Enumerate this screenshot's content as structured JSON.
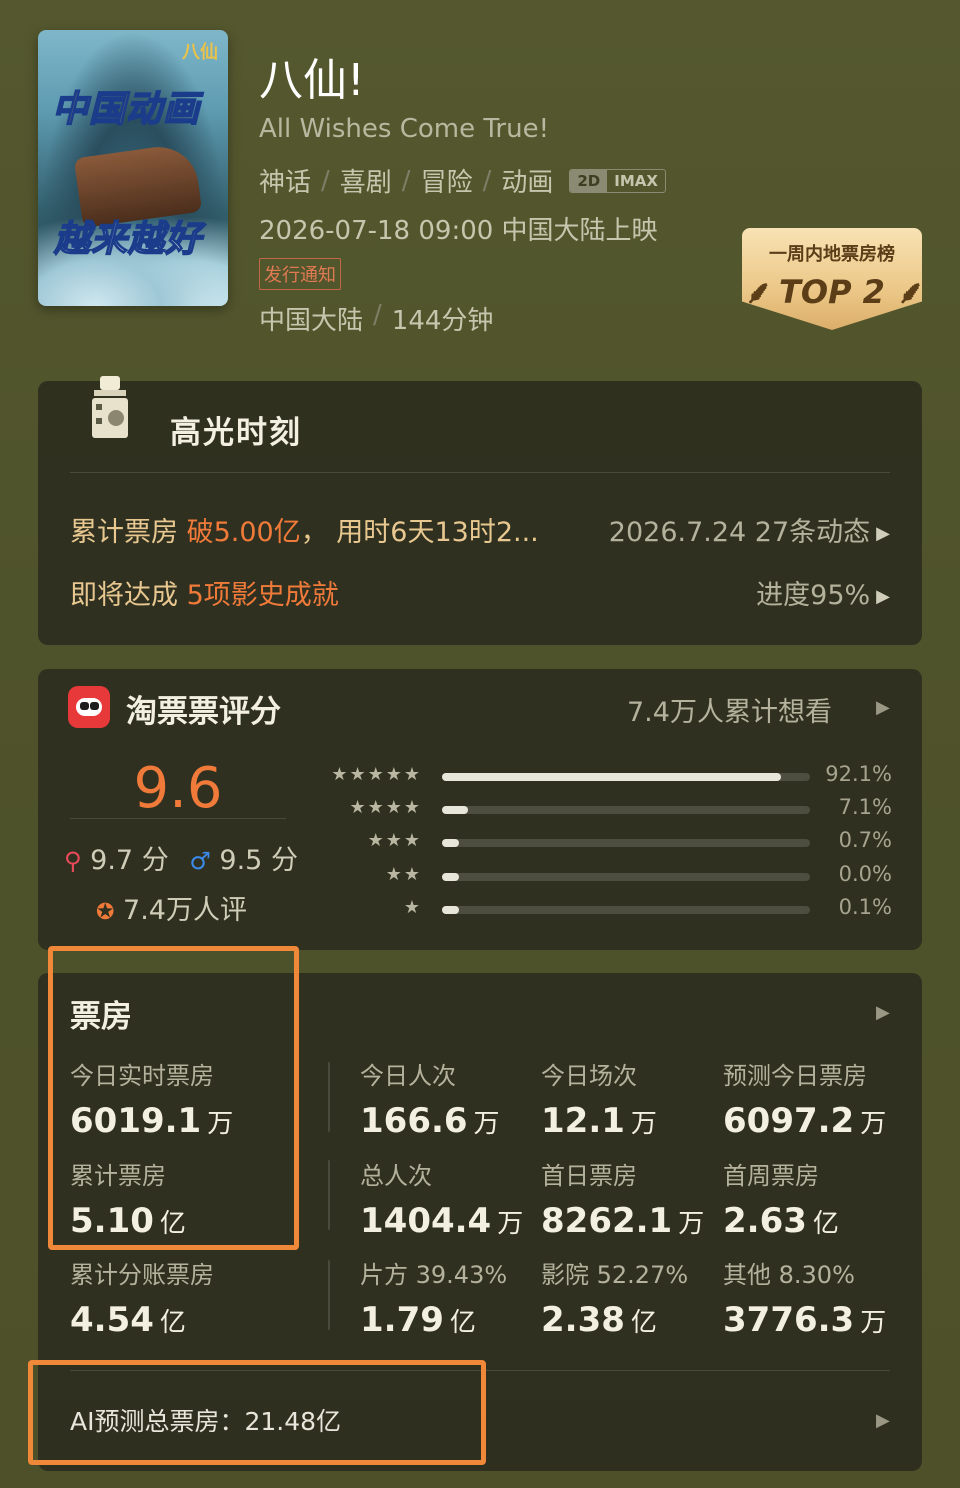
{
  "movie": {
    "poster_line1": "中国动画",
    "poster_line2": "越来越好",
    "poster_logo": "八仙",
    "title": "八仙!",
    "subtitle": "All Wishes Come True!",
    "genres": [
      "神话",
      "喜剧",
      "冒险",
      "动画"
    ],
    "formats": [
      "2D",
      "IMAX"
    ],
    "release": "2026-07-18 09:00 中国大陆上映",
    "notice": "发行通知",
    "region": "中国大陆",
    "duration": "144分钟"
  },
  "rank_badge": {
    "line1": "一周内地票房榜",
    "line2": "TOP 2"
  },
  "highlights": {
    "title": "高光时刻",
    "row1_prefix": "累计票房 ",
    "row1_hot": "破5.00亿",
    "row1_suffix": "， 用时6天13时2...",
    "row1_right": "2026.7.24  27条动态",
    "row2_prefix": "即将达成 ",
    "row2_hot": "5项影史成就",
    "row2_right": "进度95%"
  },
  "rating": {
    "platform": "淘票票评分",
    "want_to_see": "7.4万人累计想看",
    "score": "9.6",
    "female_score": "9.7",
    "male_score": "9.5",
    "score_unit": "分",
    "reviews": "7.4万人评",
    "distribution": [
      {
        "stars": "★★★★★",
        "percent": 92.1,
        "label": "92.1%"
      },
      {
        "stars": "★★★★",
        "percent": 7.1,
        "label": "7.1%"
      },
      {
        "stars": "★★★",
        "percent": 0.7,
        "label": "0.7%"
      },
      {
        "stars": "★★",
        "percent": 0.0,
        "label": "0.0%"
      },
      {
        "stars": "★",
        "percent": 0.1,
        "label": "0.1%"
      }
    ]
  },
  "boxoffice": {
    "title": "票房",
    "stats": [
      {
        "label": "今日实时票房",
        "value": "6019.1",
        "unit": "万"
      },
      {
        "label": "今日人次",
        "value": "166.6",
        "unit": "万"
      },
      {
        "label": "今日场次",
        "value": "12.1",
        "unit": "万"
      },
      {
        "label": "预测今日票房",
        "value": "6097.2",
        "unit": "万"
      },
      {
        "label": "累计票房",
        "value": "5.10",
        "unit": "亿"
      },
      {
        "label": "总人次",
        "value": "1404.4",
        "unit": "万"
      },
      {
        "label": "首日票房",
        "value": "8262.1",
        "unit": "万"
      },
      {
        "label": "首周票房",
        "value": "2.63",
        "unit": "亿"
      },
      {
        "label": "累计分账票房",
        "value": "4.54",
        "unit": "亿"
      },
      {
        "label": "片方 39.43%",
        "value": "1.79",
        "unit": "亿"
      },
      {
        "label": "影院 52.27%",
        "value": "2.38",
        "unit": "亿"
      },
      {
        "label": "其他 8.30%",
        "value": "3776.3",
        "unit": "万"
      }
    ],
    "ai_prediction": "AI预测总票房：21.48亿"
  },
  "colors": {
    "accent_orange": "#f07a3a",
    "highlight_frame": "#f0883a",
    "gold_text": "#e8c890",
    "background": "#55582e"
  }
}
